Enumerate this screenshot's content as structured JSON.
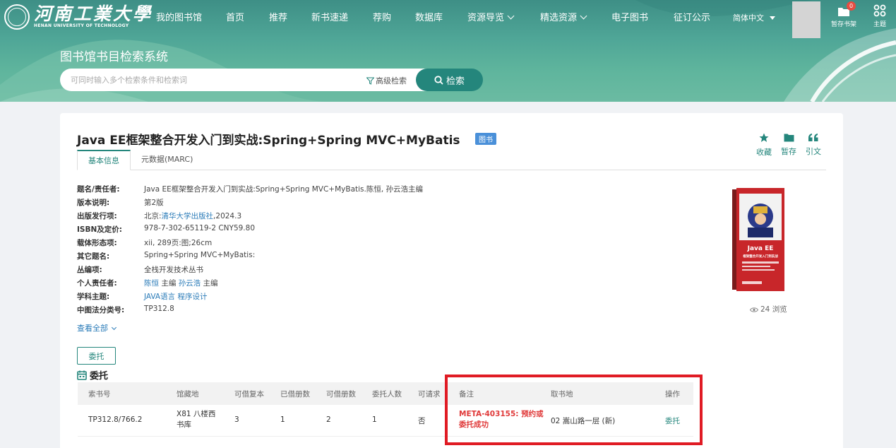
{
  "header": {
    "logo_cn": "河南工業大學",
    "logo_en": "HENAN UNIVERSITY OF TECHNOLOGY",
    "nav": [
      {
        "label": "我的图书馆",
        "dropdown": false
      },
      {
        "label": "首页",
        "dropdown": false
      },
      {
        "label": "推荐",
        "dropdown": false
      },
      {
        "label": "新书速递",
        "dropdown": false
      },
      {
        "label": "荐购",
        "dropdown": false
      },
      {
        "label": "数据库",
        "dropdown": false
      },
      {
        "label": "资源导览",
        "dropdown": true
      },
      {
        "label": "精选资源",
        "dropdown": true
      },
      {
        "label": "电子图书",
        "dropdown": false
      },
      {
        "label": "征订公示",
        "dropdown": false
      }
    ],
    "language": "简体中文",
    "shelf_label": "暂存书架",
    "shelf_count": "0",
    "theme_label": "主题"
  },
  "search": {
    "system_title": "图书馆书目检索系统",
    "placeholder": "可同时输入多个检索条件和检索词",
    "advanced_label": "高级检索",
    "button_label": "检索"
  },
  "book": {
    "title": "Java EE框架整合开发入门到实战:Spring+Spring MVC+MyBatis",
    "type_tag": "图书",
    "actions": {
      "favorite": "收藏",
      "save": "暂存",
      "cite": "引文"
    },
    "tabs": {
      "basic": "基本信息",
      "marc": "元数据(MARC)"
    },
    "fields": {
      "title_label": "题名/责任者:",
      "title_value": "Java EE框架整合开发入门到实战:Spring+Spring MVC+MyBatis.陈恒, 孙云浩主编",
      "edition_label": "版本说明:",
      "edition_value": "第2版",
      "publish_label": "出版发行项:",
      "publish_place": "北京:",
      "publisher": "清华大学出版社",
      "publish_year": ",2024.3",
      "isbn_label": "ISBN及定价:",
      "isbn_value": "978-7-302-65119-2 CNY59.80",
      "physical_label": "载体形态项:",
      "physical_value": "xii, 289页:图;26cm",
      "other_title_label": "其它题名:",
      "other_title_value": "Spring+Spring MVC+MyBatis:",
      "series_label": "丛编项:",
      "series_value": "全栈开发技术丛书",
      "person_label": "个人责任者:",
      "author1": "陈恒",
      "author1_role": " 主编 ",
      "author2": "孙云浩",
      "author2_role": " 主编",
      "subject_label": "学科主题:",
      "subject1": "JAVA语言",
      "subject2": "程序设计",
      "clc_label": "中图法分类号:",
      "clc_value": "TP312.8"
    },
    "view_all": "查看全部",
    "views": "24 浏览",
    "cover": {
      "title_line1": "Java EE",
      "title_line2": "框架整合开发入门到实战"
    }
  },
  "holdings": {
    "entrust_button": "委托",
    "section_title": "委托",
    "columns": [
      "索书号",
      "馆藏地",
      "可借复本",
      "已借册数",
      "可借册数",
      "委托人数",
      "可请求",
      "备注",
      "取书地",
      "操作"
    ],
    "rows": [
      {
        "call_number": "TP312.8/766.2",
        "location": "X81 八楼西书库",
        "copies": "3",
        "borrowed": "1",
        "available": "2",
        "requesters": "1",
        "requestable": "否",
        "note": "META-403155: 预约或委托成功",
        "pickup": "02 嵩山路一层 (新)",
        "action": "委托"
      }
    ]
  },
  "colors": {
    "accent": "#24867c",
    "link": "#2a7bb8",
    "error": "#e03a3a",
    "highlight": "#e01b24"
  }
}
